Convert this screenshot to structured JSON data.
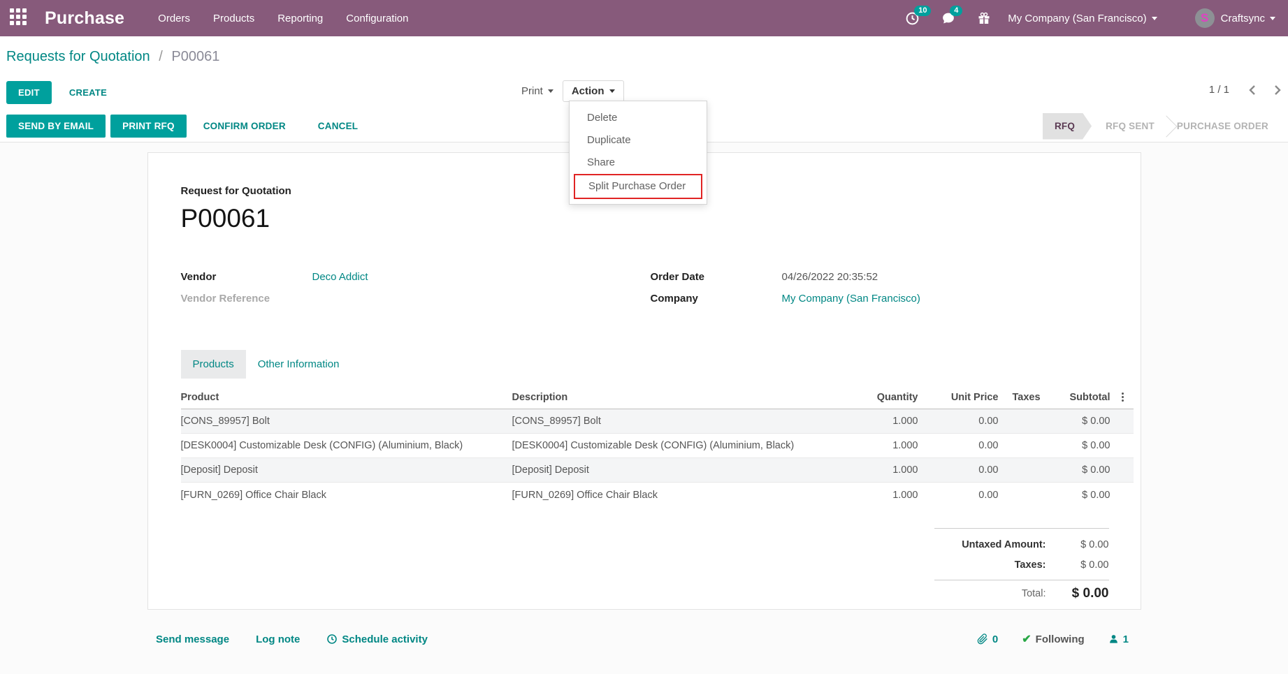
{
  "navbar": {
    "brand": "Purchase",
    "menu": [
      "Orders",
      "Products",
      "Reporting",
      "Configuration"
    ],
    "activity_count": "10",
    "message_count": "4",
    "company": "My Company (San Francisco)",
    "user": "Craftsync",
    "avatar_letter": "S"
  },
  "breadcrumb": {
    "parent": "Requests for Quotation",
    "separator": "/",
    "current": "P00061"
  },
  "controls": {
    "edit": "EDIT",
    "create": "CREATE",
    "print": "Print",
    "action": "Action",
    "pager": "1 / 1"
  },
  "action_menu": {
    "items": [
      "Delete",
      "Duplicate",
      "Share",
      "Split Purchase Order"
    ],
    "highlighted_item": "Split Purchase Order"
  },
  "statusbar": {
    "send_by_email": "SEND BY EMAIL",
    "print_rfq": "PRINT RFQ",
    "confirm_order": "CONFIRM ORDER",
    "cancel": "CANCEL",
    "states": [
      "RFQ",
      "RFQ SENT",
      "PURCHASE ORDER"
    ],
    "active_state": "RFQ"
  },
  "form": {
    "subtitle": "Request for Quotation",
    "name": "P00061",
    "vendor_label": "Vendor",
    "vendor": "Deco Addict",
    "vendor_reference_label": "Vendor Reference",
    "order_date_label": "Order Date",
    "order_date": "04/26/2022 20:35:52",
    "company_label": "Company",
    "company": "My Company (San Francisco)",
    "tabs": [
      "Products",
      "Other Information"
    ],
    "active_tab": "Products"
  },
  "table": {
    "headers": [
      "Product",
      "Description",
      "Quantity",
      "Unit Price",
      "Taxes",
      "Subtotal"
    ],
    "rows": [
      {
        "product": "[CONS_89957] Bolt",
        "description": "[CONS_89957] Bolt",
        "quantity": "1.000",
        "unit_price": "0.00",
        "taxes": "",
        "subtotal": "$ 0.00"
      },
      {
        "product": "[DESK0004] Customizable Desk (CONFIG) (Aluminium, Black)",
        "description": "[DESK0004] Customizable Desk (CONFIG) (Aluminium, Black)",
        "quantity": "1.000",
        "unit_price": "0.00",
        "taxes": "",
        "subtotal": "$ 0.00"
      },
      {
        "product": "[Deposit] Deposit",
        "description": "[Deposit] Deposit",
        "quantity": "1.000",
        "unit_price": "0.00",
        "taxes": "",
        "subtotal": "$ 0.00"
      },
      {
        "product": "[FURN_0269] Office Chair Black",
        "description": "[FURN_0269] Office Chair Black",
        "quantity": "1.000",
        "unit_price": "0.00",
        "taxes": "",
        "subtotal": "$ 0.00"
      }
    ]
  },
  "totals": {
    "untaxed_label": "Untaxed Amount:",
    "untaxed_value": "$ 0.00",
    "taxes_label": "Taxes:",
    "taxes_value": "$ 0.00",
    "total_label": "Total:",
    "total_value": "$ 0.00"
  },
  "chatter": {
    "send_message": "Send message",
    "log_note": "Log note",
    "schedule_activity": "Schedule activity",
    "attachment_count": "0",
    "following": "Following",
    "follower_count": "1"
  },
  "colors": {
    "navbar": "#875A7B",
    "accent": "#00A09D",
    "link": "#008784",
    "highlight_red": "#E02424",
    "check_green": "#28A745",
    "state_active_text": "#5B3A53"
  }
}
